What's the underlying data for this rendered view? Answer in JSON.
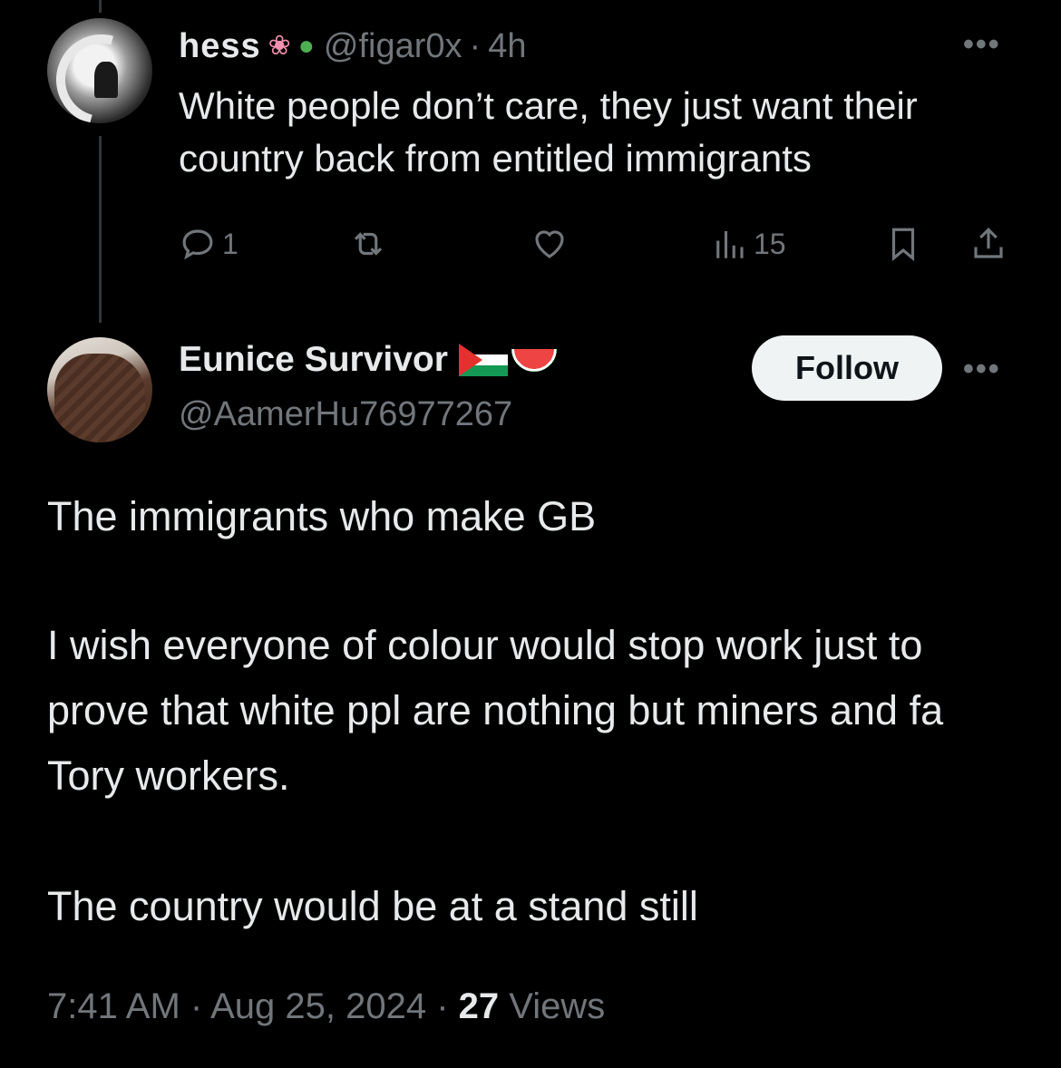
{
  "parent_tweet": {
    "display_name": "hess",
    "handle": "@figar0x",
    "time": "4h",
    "text": "White people don’t care, they just want their country back from entitled immigrants",
    "reply_count": "1",
    "view_count": "15"
  },
  "main_tweet": {
    "display_name": "Eunice Survivor",
    "handle": "@AamerHu76977267",
    "follow_label": "Follow",
    "paragraph_1": "The immigrants who make GB",
    "paragraph_2": "I wish everyone of colour would stop work just to prove that white ppl are nothing but miners and fa Tory workers.",
    "paragraph_3": "The country would be at a stand still",
    "timestamp": "7:41 AM · Aug 25, 2024 · ",
    "views_count": "27",
    "views_label": " Views"
  },
  "icons": [
    "more-icon",
    "reply-icon",
    "repost-icon",
    "like-icon",
    "views-icon",
    "bookmark-icon",
    "share-icon",
    "lotus-emoji",
    "beetle-emoji",
    "palestine-flag-emoji",
    "watermelon-emoji"
  ],
  "colors": {
    "background": "#000000",
    "text": "#e7e9ea",
    "secondary": "#71767b",
    "follow_bg": "#eff3f4"
  }
}
